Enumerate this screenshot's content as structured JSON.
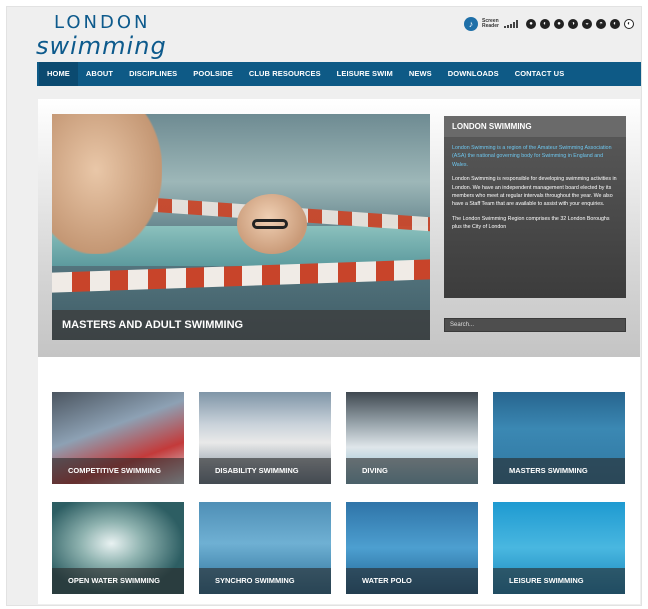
{
  "logo": {
    "line1": "LONDON",
    "line2": "swimming"
  },
  "accessibility": {
    "screen_reader_label": "Screen Reader",
    "icons": [
      "screen-reader-icon",
      "text-size-icon",
      "contrast-icon"
    ]
  },
  "nav": {
    "items": [
      "HOME",
      "ABOUT",
      "DISCIPLINES",
      "POOLSIDE",
      "CLUB RESOURCES",
      "LEISURE SWIM",
      "NEWS",
      "DOWNLOADS",
      "CONTACT US"
    ],
    "active": "HOME"
  },
  "hero": {
    "caption": "MASTERS AND ADULT SWIMMING"
  },
  "info_panel": {
    "title": "LONDON SWIMMING",
    "intro": "London Swimming is a region of the Amateur Swimming Association (ASA) the national governing body for Swimming in England and Wales.",
    "body1": "London Swimming is responsible for developing swimming activities in London. We have an independent management board elected by its members who meet at regular intervals throughout the year. We also have a Staff Team that are available to assist with your enquiries.",
    "body2": "The London Swimming Region comprises the 32 London Boroughs plus the City of London"
  },
  "search": {
    "placeholder": "Search..."
  },
  "tiles": [
    "COMPETITIVE SWIMMING",
    "DISABILITY SWIMMING",
    "DIVING",
    "MASTERS SWIMMING",
    "OPEN WATER SWIMMING",
    "SYNCHRO SWIMMING",
    "WATER POLO",
    "LEISURE SWIMMING"
  ],
  "colors": {
    "nav_bg": "#0e5a86",
    "brand": "#0d5a8c",
    "panel_link": "#6ec6ee"
  }
}
